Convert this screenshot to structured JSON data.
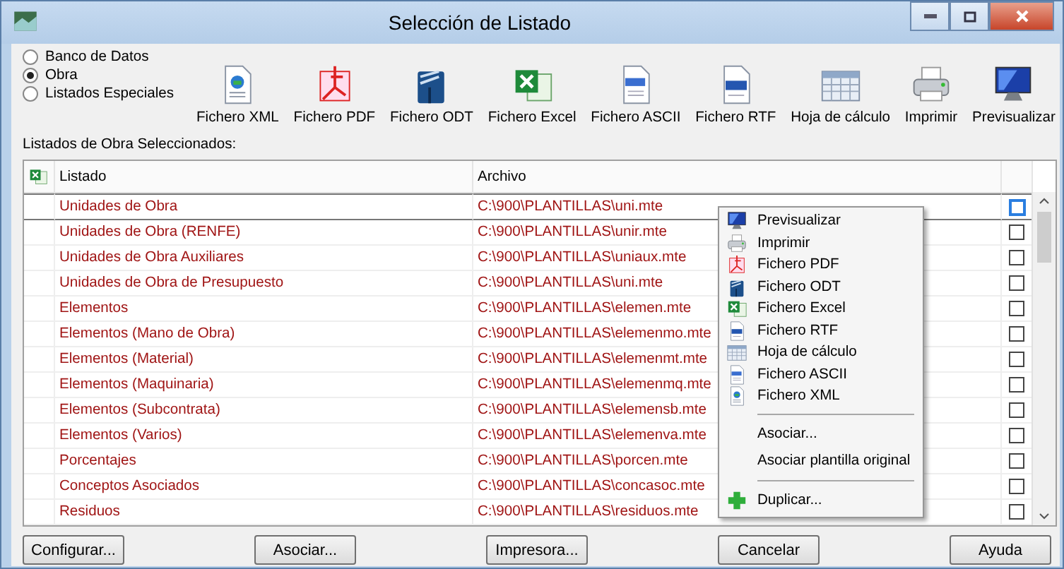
{
  "window": {
    "title": "Selección de Listado"
  },
  "sources": [
    {
      "label": "Banco de Datos",
      "selected": false
    },
    {
      "label": "Obra",
      "selected": true
    },
    {
      "label": "Listados Especiales",
      "selected": false
    }
  ],
  "toolbar": [
    {
      "kind": "xml",
      "label": "Fichero XML"
    },
    {
      "kind": "pdf",
      "label": "Fichero PDF"
    },
    {
      "kind": "odt",
      "label": "Fichero ODT"
    },
    {
      "kind": "excel",
      "label": "Fichero Excel"
    },
    {
      "kind": "ascii",
      "label": "Fichero ASCII"
    },
    {
      "kind": "rtf",
      "label": "Fichero RTF"
    },
    {
      "kind": "sheet",
      "label": "Hoja de cálculo"
    },
    {
      "kind": "print",
      "label": "Imprimir"
    },
    {
      "kind": "preview",
      "label": "Previsualizar"
    }
  ],
  "list_label": "Listados de Obra Seleccionados:",
  "table": {
    "columns": [
      "Listado",
      "Archivo"
    ],
    "rows": [
      {
        "listado": "Unidades de Obra",
        "archivo": "C:\\900\\PLANTILLAS\\uni.mte",
        "checked": false,
        "selected": true
      },
      {
        "listado": "Unidades de Obra (RENFE)",
        "archivo": "C:\\900\\PLANTILLAS\\unir.mte",
        "checked": false,
        "selected": false
      },
      {
        "listado": "Unidades de Obra Auxiliares",
        "archivo": "C:\\900\\PLANTILLAS\\uniaux.mte",
        "checked": false,
        "selected": false
      },
      {
        "listado": "Unidades de Obra de Presupuesto",
        "archivo": "C:\\900\\PLANTILLAS\\uni.mte",
        "checked": false,
        "selected": false
      },
      {
        "listado": "Elementos",
        "archivo": "C:\\900\\PLANTILLAS\\elemen.mte",
        "checked": false,
        "selected": false
      },
      {
        "listado": "Elementos (Mano de Obra)",
        "archivo": "C:\\900\\PLANTILLAS\\elemenmo.mte",
        "checked": false,
        "selected": false
      },
      {
        "listado": "Elementos (Material)",
        "archivo": "C:\\900\\PLANTILLAS\\elemenmt.mte",
        "checked": false,
        "selected": false
      },
      {
        "listado": "Elementos (Maquinaria)",
        "archivo": "C:\\900\\PLANTILLAS\\elemenmq.mte",
        "checked": false,
        "selected": false
      },
      {
        "listado": "Elementos (Subcontrata)",
        "archivo": "C:\\900\\PLANTILLAS\\elemensb.mte",
        "checked": false,
        "selected": false
      },
      {
        "listado": "Elementos (Varios)",
        "archivo": "C:\\900\\PLANTILLAS\\elemenva.mte",
        "checked": false,
        "selected": false
      },
      {
        "listado": "Porcentajes",
        "archivo": "C:\\900\\PLANTILLAS\\porcen.mte",
        "checked": false,
        "selected": false
      },
      {
        "listado": "Conceptos Asociados",
        "archivo": "C:\\900\\PLANTILLAS\\concasoc.mte",
        "checked": false,
        "selected": false
      },
      {
        "listado": "Residuos",
        "archivo": "C:\\900\\PLANTILLAS\\residuos.mte",
        "checked": false,
        "selected": false
      }
    ]
  },
  "context_menu": {
    "items": [
      {
        "kind": "preview",
        "label": "Previsualizar"
      },
      {
        "kind": "print",
        "label": "Imprimir"
      },
      {
        "kind": "pdf",
        "label": "Fichero PDF"
      },
      {
        "kind": "odt",
        "label": "Fichero ODT"
      },
      {
        "kind": "excel",
        "label": "Fichero Excel"
      },
      {
        "kind": "rtf",
        "label": "Fichero RTF"
      },
      {
        "kind": "sheet",
        "label": "Hoja de cálculo"
      },
      {
        "kind": "ascii",
        "label": "Fichero ASCII"
      },
      {
        "kind": "xml",
        "label": "Fichero XML"
      },
      {
        "kind": "separator"
      },
      {
        "kind": "plain",
        "label": "Asociar..."
      },
      {
        "kind": "plain",
        "label": "Asociar plantilla original"
      },
      {
        "kind": "separator"
      },
      {
        "kind": "add",
        "label": "Duplicar..."
      }
    ]
  },
  "buttons": [
    "Configurar...",
    "Asociar...",
    "Impresora...",
    "Cancelar",
    "Ayuda"
  ]
}
